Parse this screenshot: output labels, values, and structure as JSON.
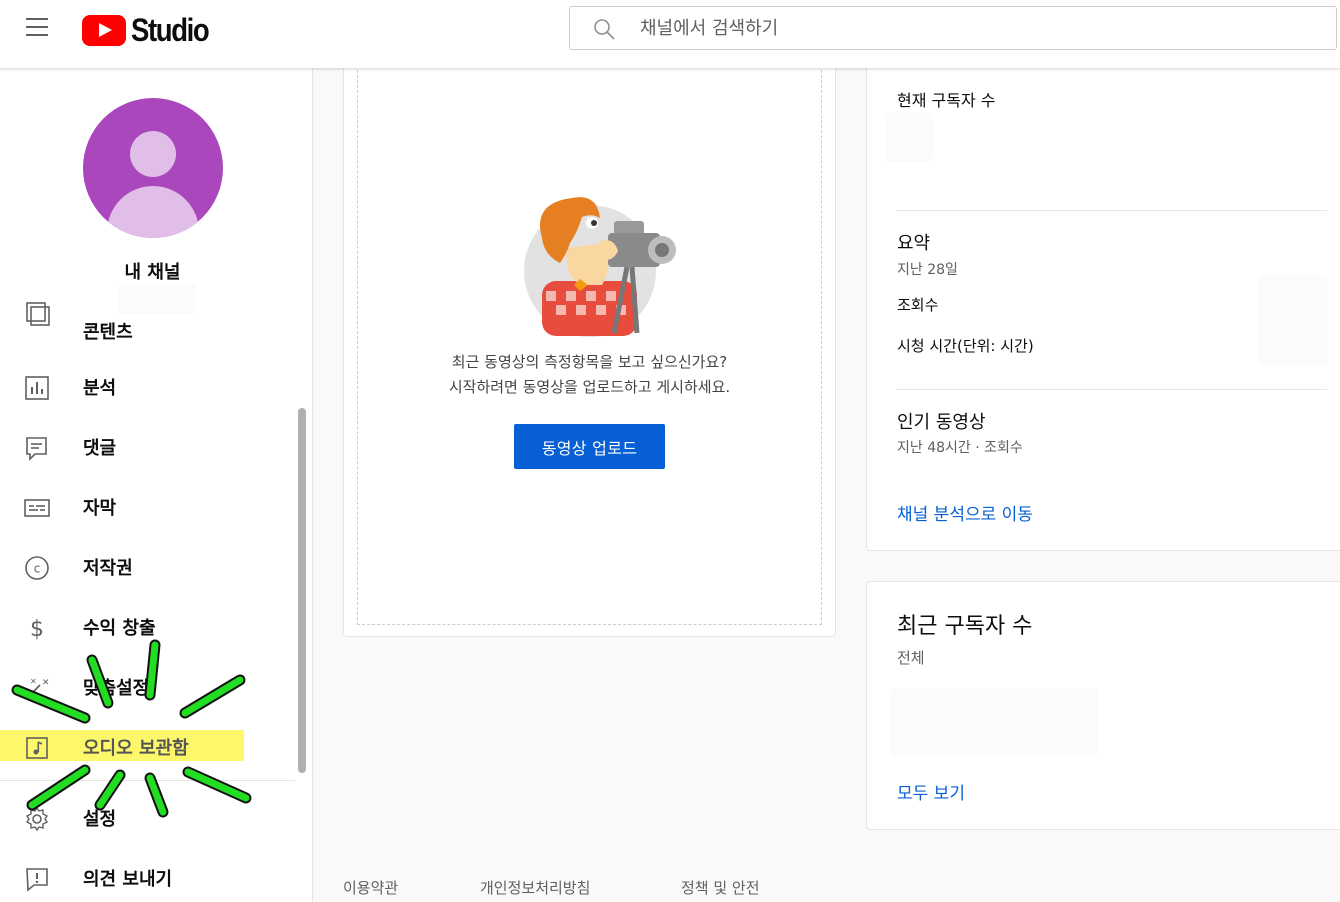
{
  "header": {
    "logo_text": "Studio",
    "search_placeholder": "채널에서 검색하기"
  },
  "sidebar": {
    "channel_name": "내 채널",
    "items": [
      {
        "label": "콘텐츠",
        "icon": "content-icon"
      },
      {
        "label": "분석",
        "icon": "analytics-icon"
      },
      {
        "label": "댓글",
        "icon": "comments-icon"
      },
      {
        "label": "자막",
        "icon": "subtitles-icon"
      },
      {
        "label": "저작권",
        "icon": "copyright-icon"
      },
      {
        "label": "수익 창출",
        "icon": "dollar-icon"
      },
      {
        "label": "맞춤설정",
        "icon": "magic-wand-icon"
      },
      {
        "label": "오디오 보관함",
        "icon": "audio-library-icon"
      },
      {
        "label": "설정",
        "icon": "gear-icon"
      },
      {
        "label": "의견 보내기",
        "icon": "feedback-icon"
      }
    ],
    "highlight_color": "#fdf76a",
    "annotation_color": "#22dd22"
  },
  "main": {
    "prompt_line1": "최근 동영상의 측정항목을 보고 싶으신가요?",
    "prompt_line2": "시작하려면 동영상을 업로드하고 게시하세요.",
    "upload_button": "동영상 업로드"
  },
  "analytics": {
    "current_subscribers": "현재 구독자 수",
    "summary_title": "요약",
    "summary_period": "지난 28일",
    "views": "조회수",
    "watch_time": "시청 시간(단위: 시간)",
    "top_videos_title": "인기 동영상",
    "top_videos_sub": "지난 48시간 · 조회수",
    "go_to_analytics": "채널 분석으로 이동"
  },
  "recent_subscribers": {
    "title": "최근 구독자 수",
    "sub": "전체",
    "see_all": "모두 보기"
  },
  "footer": {
    "terms": "이용약관",
    "privacy": "개인정보처리방침",
    "policy": "정책 및 안전"
  },
  "colors": {
    "accent": "#065fd4",
    "brand": "#ff0000",
    "avatar": "#ab47bc"
  }
}
